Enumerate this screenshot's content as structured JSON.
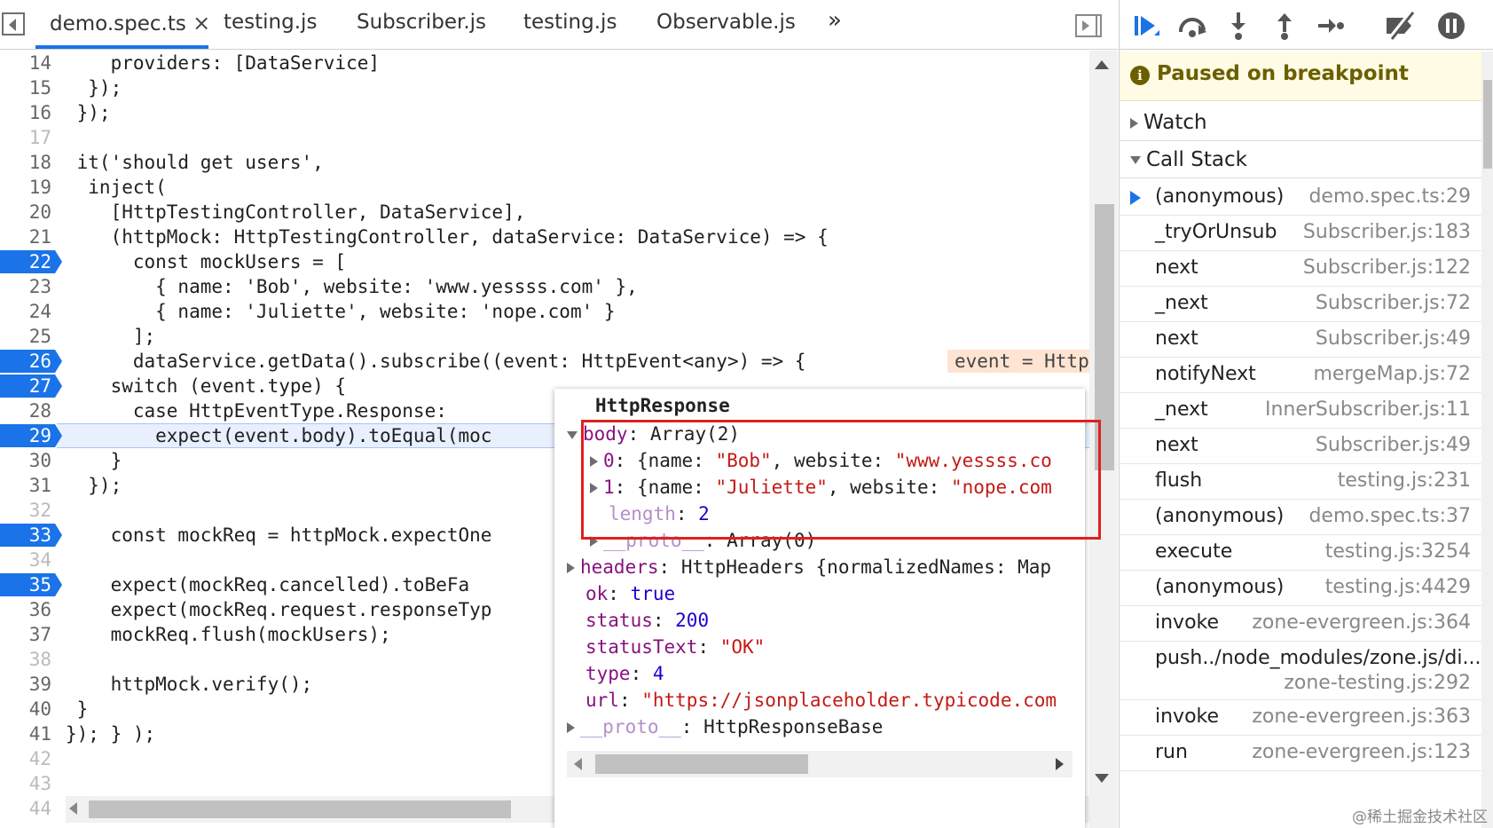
{
  "tabs": {
    "items": [
      "demo.spec.ts",
      "testing.js",
      "Subscriber.js",
      "testing.js",
      "Observable.js"
    ],
    "close_glyph": "×",
    "more_glyph": "»",
    "active_index": 0
  },
  "editor": {
    "lines": [
      {
        "n": "14",
        "code": "    providers: [DataService]"
      },
      {
        "n": "15",
        "code": "  });"
      },
      {
        "n": "16",
        "code": " });"
      },
      {
        "n": "17",
        "code": ""
      },
      {
        "n": "18",
        "code": " it('should get users',"
      },
      {
        "n": "19",
        "code": "  inject("
      },
      {
        "n": "20",
        "code": "    [HttpTestingController, DataService],"
      },
      {
        "n": "21",
        "code": "    (httpMock: HttpTestingController, dataService: DataService) => {"
      },
      {
        "n": "22",
        "code": "      const mockUsers = ["
      },
      {
        "n": "23",
        "code": "        { name: 'Bob', website: 'www.yessss.com' },"
      },
      {
        "n": "24",
        "code": "        { name: 'Juliette', website: 'nope.com' }"
      },
      {
        "n": "25",
        "code": "      ];"
      },
      {
        "n": "26",
        "code": "      dataService.getData().subscribe((event: HttpEvent<any>) => {"
      },
      {
        "n": "27",
        "code": "    switch (event.type) {"
      },
      {
        "n": "28",
        "code": "      case HttpEventType.Response:"
      },
      {
        "n": "29",
        "code": "        expect(event.body).toEqual(moc"
      },
      {
        "n": "30",
        "code": "    }"
      },
      {
        "n": "31",
        "code": "  });"
      },
      {
        "n": "32",
        "code": ""
      },
      {
        "n": "33",
        "code": "    const mockReq = httpMock.expectOne"
      },
      {
        "n": "34",
        "code": ""
      },
      {
        "n": "35",
        "code": "    expect(mockReq.cancelled).toBeFa"
      },
      {
        "n": "36",
        "code": "    expect(mockReq.request.responseTyp"
      },
      {
        "n": "37",
        "code": "    mockReq.flush(mockUsers);"
      },
      {
        "n": "38",
        "code": ""
      },
      {
        "n": "39",
        "code": "    httpMock.verify();"
      },
      {
        "n": "40",
        "code": " }"
      },
      {
        "n": "41",
        "code": "}); } );"
      },
      {
        "n": "42",
        "code": ""
      },
      {
        "n": "43",
        "code": ""
      },
      {
        "n": "44",
        "code": ""
      }
    ],
    "breakpoint_lines": [
      "22",
      "26",
      "27",
      "29",
      "33",
      "35"
    ],
    "current_line": "29",
    "inline_value": "event = HttpRes"
  },
  "popover": {
    "title": "HttpResponse",
    "body_key": "body",
    "body_value": "Array(2)",
    "items": [
      {
        "index": "0",
        "name": "\"Bob\"",
        "website": "\"www.yessss.co"
      },
      {
        "index": "1",
        "name": "\"Juliette\"",
        "website": "\"nope.com"
      }
    ],
    "length_key": "length",
    "length_value": "2",
    "array_proto_key": "__proto__",
    "array_proto_value": "Array(0)",
    "headers_key": "headers",
    "headers_value": "HttpHeaders {normalizedNames: Map",
    "ok_key": "ok",
    "ok_value": "true",
    "status_key": "status",
    "status_value": "200",
    "statusText_key": "statusText",
    "statusText_value": "\"OK\"",
    "type_key": "type",
    "type_value": "4",
    "url_key": "url",
    "url_value": "\"https://jsonplaceholder.typicode.com",
    "proto_key": "__proto__",
    "proto_value": "HttpResponseBase"
  },
  "sidebar": {
    "paused_text": "Paused on breakpoint",
    "paused_icon": "info-icon",
    "watch_label": "Watch",
    "callstack_label": "Call Stack",
    "frames": [
      {
        "fn": "(anonymous)",
        "loc": "demo.spec.ts:29",
        "current": true
      },
      {
        "fn": "_tryOrUnsub",
        "loc": "Subscriber.js:183"
      },
      {
        "fn": "next",
        "loc": "Subscriber.js:122"
      },
      {
        "fn": "_next",
        "loc": "Subscriber.js:72"
      },
      {
        "fn": "next",
        "loc": "Subscriber.js:49"
      },
      {
        "fn": "notifyNext",
        "loc": "mergeMap.js:72"
      },
      {
        "fn": "_next",
        "loc": "InnerSubscriber.js:11"
      },
      {
        "fn": "next",
        "loc": "Subscriber.js:49"
      },
      {
        "fn": "flush",
        "loc": "testing.js:231"
      },
      {
        "fn": "(anonymous)",
        "loc": "demo.spec.ts:37"
      },
      {
        "fn": "execute",
        "loc": "testing.js:3254"
      },
      {
        "fn": "(anonymous)",
        "loc": "testing.js:4429"
      },
      {
        "fn": "invoke",
        "loc": "zone-evergreen.js:364"
      },
      {
        "fn": "push../node_modules/zone.js/di...",
        "loc": "zone-testing.js:292",
        "wrap": true
      },
      {
        "fn": "invoke",
        "loc": "zone-evergreen.js:363"
      },
      {
        "fn": "run",
        "loc": "zone-evergreen.js:123"
      }
    ]
  },
  "watermark": "@稀土掘金技术社区",
  "colors": {
    "accent": "#1a73e8",
    "paused_bg": "#fffbe5",
    "highlight_box": "#e02020"
  }
}
